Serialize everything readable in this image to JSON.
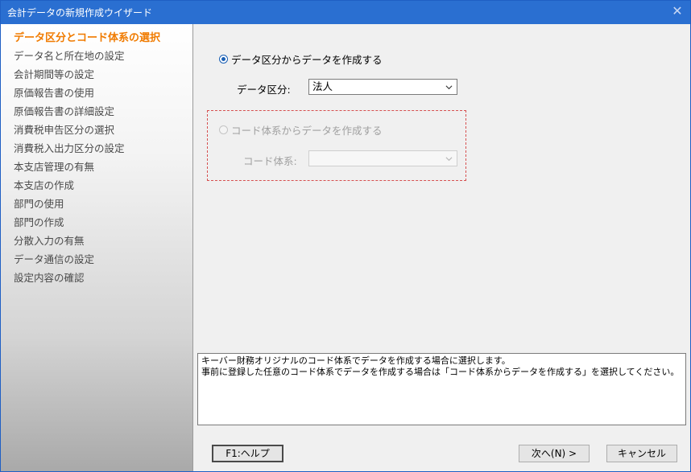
{
  "window": {
    "title": "会計データの新規作成ウイザード",
    "close_glyph": "✕"
  },
  "sidebar": {
    "steps": [
      {
        "label": "データ区分とコード体系の選択",
        "state": "active"
      },
      {
        "label": "データ名と所在地の設定",
        "state": "enabled"
      },
      {
        "label": "会計期間等の設定",
        "state": "enabled"
      },
      {
        "label": "原価報告書の使用",
        "state": "enabled"
      },
      {
        "label": "原価報告書の詳細設定",
        "state": "enabled"
      },
      {
        "label": "消費税申告区分の選択",
        "state": "enabled"
      },
      {
        "label": "消費税入出力区分の設定",
        "state": "enabled"
      },
      {
        "label": "本支店管理の有無",
        "state": "enabled"
      },
      {
        "label": "本支店の作成",
        "state": "enabled"
      },
      {
        "label": "部門の使用",
        "state": "enabled"
      },
      {
        "label": "部門の作成",
        "state": "enabled"
      },
      {
        "label": "分散入力の有無",
        "state": "enabled"
      },
      {
        "label": "データ通信の設定",
        "state": "enabled"
      },
      {
        "label": "設定内容の確認",
        "state": "enabled"
      }
    ]
  },
  "options": {
    "data_category": {
      "label": "データ区分からデータを作成する",
      "selected": true,
      "field_label": "データ区分:",
      "value": "法人"
    },
    "code_system": {
      "label": "コード体系からデータを作成する",
      "selected": false,
      "field_label": "コード体系:",
      "value": ""
    }
  },
  "description": {
    "line1": "キーバー財務オリジナルのコード体系でデータを作成する場合に選択します。",
    "line2": "事前に登録した任意のコード体系でデータを作成する場合は「コード体系からデータを作成する」を選択してください。"
  },
  "buttons": {
    "help": "F1:ヘルプ",
    "next": "次へ(N) >",
    "cancel": "キャンセル"
  },
  "colors": {
    "title_bar": "#2a6fd1",
    "active_step": "#f07b00",
    "enabled_step": "#4a4a4a",
    "disabled_text": "#a0a0a0",
    "dashed_border": "#d65050"
  }
}
